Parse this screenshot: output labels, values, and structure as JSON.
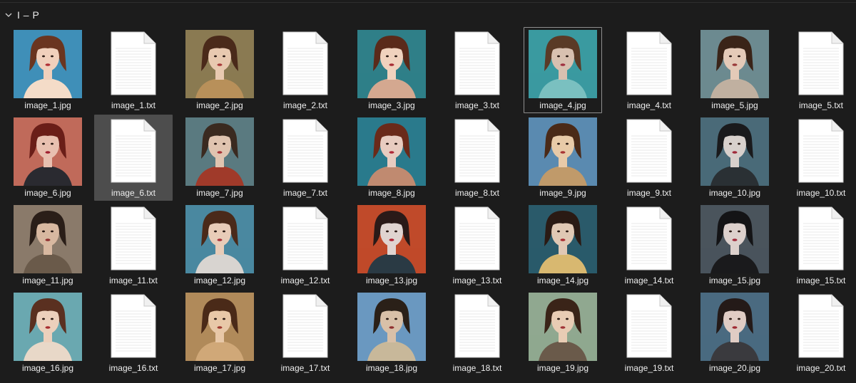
{
  "group": {
    "title": "I – P"
  },
  "colors": {
    "background": "#1c1c1c",
    "selected": "#4d4d4d",
    "text": "#eeeeee"
  },
  "files": [
    {
      "name": "image_1.jpg",
      "type": "image",
      "palette": [
        "#3f8fb8",
        "#f0d0bc",
        "#6a3520",
        "#b03036",
        "#f4dcc8"
      ]
    },
    {
      "name": "image_1.txt",
      "type": "text"
    },
    {
      "name": "image_2.jpg",
      "type": "image",
      "palette": [
        "#8a7a52",
        "#e8c9b0",
        "#4a2a1a",
        "#a83a3a",
        "#b8905a"
      ]
    },
    {
      "name": "image_2.txt",
      "type": "text"
    },
    {
      "name": "image_3.jpg",
      "type": "image",
      "palette": [
        "#2f7f88",
        "#f0d2be",
        "#5a2a1a",
        "#a82c34",
        "#d4a890"
      ]
    },
    {
      "name": "image_3.txt",
      "type": "text"
    },
    {
      "name": "image_4.jpg",
      "type": "image",
      "palette": [
        "#3a9aa0",
        "#d8c0b0",
        "#5a3a26",
        "#a03040",
        "#7ac0c0"
      ]
    },
    {
      "name": "image_4.txt",
      "type": "text"
    },
    {
      "name": "image_5.jpg",
      "type": "image",
      "palette": [
        "#6c8a90",
        "#e4cab8",
        "#3a2418",
        "#9a3a3a",
        "#c0b0a0"
      ]
    },
    {
      "name": "image_5.txt",
      "type": "text"
    },
    {
      "name": "image_6.jpg",
      "type": "image",
      "palette": [
        "#c06a5a",
        "#e8c0b0",
        "#6a1e18",
        "#a02030",
        "#2a2a30"
      ]
    },
    {
      "name": "image_6.txt",
      "type": "text"
    },
    {
      "name": "image_7.jpg",
      "type": "image",
      "palette": [
        "#5a7a80",
        "#e0c4b0",
        "#3a2a20",
        "#a83438",
        "#a03a2a"
      ]
    },
    {
      "name": "image_7.txt",
      "type": "text"
    },
    {
      "name": "image_8.jpg",
      "type": "image",
      "palette": [
        "#2a7a8c",
        "#e8ccc0",
        "#6a2a1a",
        "#b02838",
        "#c08a70"
      ]
    },
    {
      "name": "image_8.txt",
      "type": "text"
    },
    {
      "name": "image_9.jpg",
      "type": "image",
      "palette": [
        "#5a8ab0",
        "#e8caa8",
        "#4a2a18",
        "#a83434",
        "#c09a6a"
      ]
    },
    {
      "name": "image_9.txt",
      "type": "text"
    },
    {
      "name": "image_10.jpg",
      "type": "image",
      "palette": [
        "#4a6a78",
        "#d8d0cc",
        "#1a1a1c",
        "#a02a3a",
        "#2a3034"
      ]
    },
    {
      "name": "image_10.txt",
      "type": "text"
    },
    {
      "name": "image_11.jpg",
      "type": "image",
      "palette": [
        "#8a7a6a",
        "#d8b8a0",
        "#2a1e18",
        "#903030",
        "#6a5a4a"
      ]
    },
    {
      "name": "image_11.txt",
      "type": "text"
    },
    {
      "name": "image_12.jpg",
      "type": "image",
      "palette": [
        "#4a88a0",
        "#e8ccb8",
        "#4a2a1a",
        "#a83038",
        "#d8d4d0"
      ]
    },
    {
      "name": "image_12.txt",
      "type": "text"
    },
    {
      "name": "image_13.jpg",
      "type": "image",
      "palette": [
        "#c04a2a",
        "#e0d4d0",
        "#2a1a18",
        "#b02030",
        "#2a3a44"
      ]
    },
    {
      "name": "image_13.txt",
      "type": "text"
    },
    {
      "name": "image_14.jpg",
      "type": "image",
      "palette": [
        "#2a5a6a",
        "#e0c8b4",
        "#2a1a14",
        "#a82a30",
        "#d8b870"
      ]
    },
    {
      "name": "image_14.txt",
      "type": "text"
    },
    {
      "name": "image_15.jpg",
      "type": "image",
      "palette": [
        "#4a545c",
        "#dcd0cc",
        "#141416",
        "#a0283a",
        "#1a1a1c"
      ]
    },
    {
      "name": "image_15.txt",
      "type": "text"
    },
    {
      "name": "image_16.jpg",
      "type": "image",
      "palette": [
        "#6aa8b0",
        "#ecd0bc",
        "#5a3020",
        "#a82c30",
        "#e8d8c8"
      ]
    },
    {
      "name": "image_16.txt",
      "type": "text"
    },
    {
      "name": "image_17.jpg",
      "type": "image",
      "palette": [
        "#b08a5a",
        "#e8c8a8",
        "#4a2a18",
        "#a03a30",
        "#d0a878"
      ]
    },
    {
      "name": "image_17.txt",
      "type": "text"
    },
    {
      "name": "image_18.jpg",
      "type": "image",
      "palette": [
        "#6a98c0",
        "#d8c0a8",
        "#2a2018",
        "#903030",
        "#c8b89a"
      ]
    },
    {
      "name": "image_18.txt",
      "type": "text"
    },
    {
      "name": "image_19.jpg",
      "type": "image",
      "palette": [
        "#90a890",
        "#e8ccb4",
        "#3a2418",
        "#a03438",
        "#6a5a4a"
      ]
    },
    {
      "name": "image_19.txt",
      "type": "text"
    },
    {
      "name": "image_20.jpg",
      "type": "image",
      "palette": [
        "#4a6a80",
        "#e0ccc4",
        "#241a18",
        "#a02a34",
        "#3a3a3e"
      ]
    },
    {
      "name": "image_20.txt",
      "type": "text"
    }
  ],
  "selected_file": "image_6.txt",
  "focused_file": "image_4.jpg"
}
